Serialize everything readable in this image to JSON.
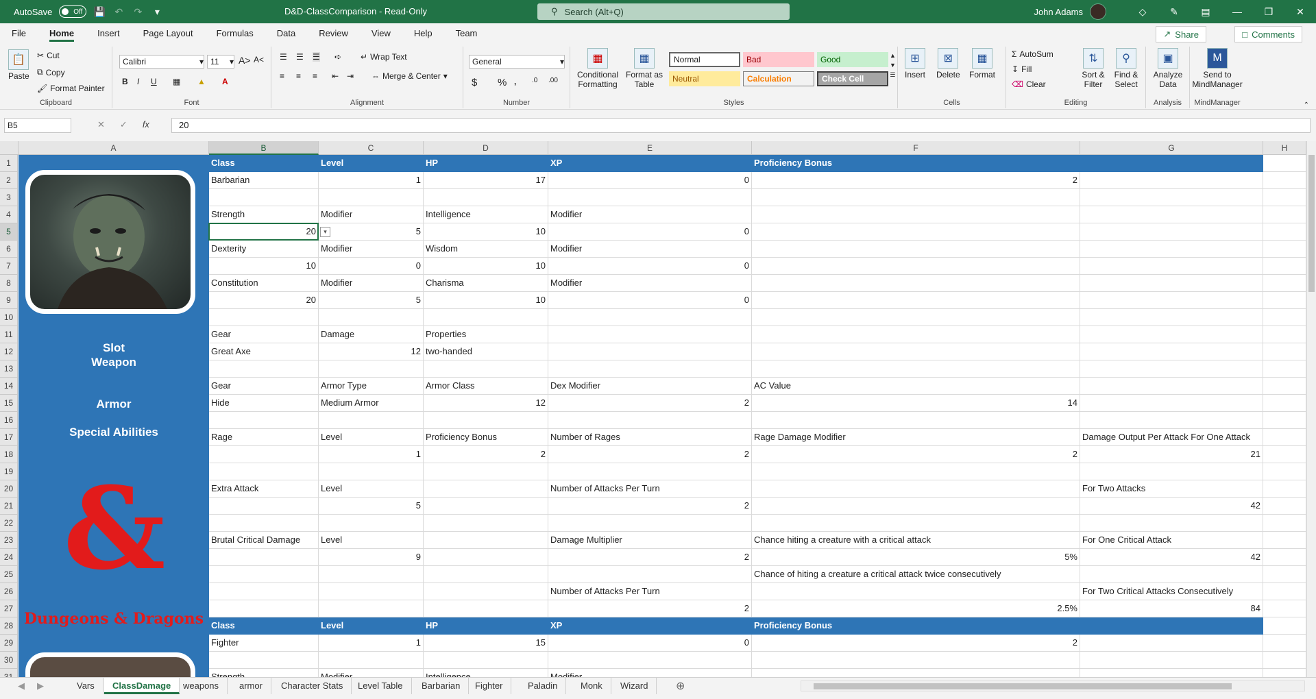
{
  "titlebar": {
    "autosave_label": "AutoSave",
    "autosave_state": "Off",
    "doc_title": "D&D-ClassComparison - Read-Only",
    "search_placeholder": "Search (Alt+Q)",
    "user_name": "John Adams"
  },
  "ribbon_tabs": [
    "File",
    "Home",
    "Insert",
    "Page Layout",
    "Formulas",
    "Data",
    "Review",
    "View",
    "Help",
    "Team"
  ],
  "share_label": "Share",
  "comments_label": "Comments",
  "ribbon": {
    "clipboard": {
      "label": "Clipboard",
      "paste": "Paste",
      "cut": "Cut",
      "copy": "Copy",
      "format_painter": "Format Painter"
    },
    "font": {
      "label": "Font",
      "family": "Calibri",
      "size": "11"
    },
    "alignment": {
      "label": "Alignment",
      "wrap_text": "Wrap Text",
      "merge_center": "Merge & Center"
    },
    "number": {
      "label": "Number",
      "format": "General"
    },
    "styles": {
      "label": "Styles",
      "conditional": "Conditional Formatting",
      "format_table": "Format as Table",
      "normal": "Normal",
      "bad": "Bad",
      "good": "Good",
      "neutral": "Neutral",
      "calculation": "Calculation",
      "check_cell": "Check Cell"
    },
    "cells": {
      "label": "Cells",
      "insert": "Insert",
      "delete": "Delete",
      "format": "Format"
    },
    "editing": {
      "label": "Editing",
      "autosum": "AutoSum",
      "fill": "Fill",
      "clear": "Clear",
      "sort_filter": "Sort & Filter",
      "find_select": "Find & Select"
    },
    "analysis": {
      "label": "Analysis",
      "analyze": "Analyze Data"
    },
    "mindmanager": {
      "label": "MindManager",
      "send": "Send to MindManager"
    }
  },
  "formula_bar": {
    "name_box": "B5",
    "formula": "20"
  },
  "columns": [
    "A",
    "B",
    "C",
    "D",
    "E",
    "F",
    "G",
    "H"
  ],
  "sidebar": {
    "slot": "Slot",
    "weapon": "Weapon",
    "armor": "Armor",
    "special": "Special Abilities",
    "logo_text": "Dungeons & Dragons"
  },
  "rows": [
    {
      "n": "1",
      "hdr": true,
      "B": "Class",
      "C": "Level",
      "D": "HP",
      "E": "XP",
      "F": "Proficiency Bonus",
      "G": ""
    },
    {
      "n": "2",
      "B": "Barbarian",
      "C": "1",
      "D": "17",
      "E": "0",
      "F": "2",
      "G": "",
      "num": [
        "C",
        "D",
        "E",
        "F"
      ]
    },
    {
      "n": "3"
    },
    {
      "n": "4",
      "B": "Strength",
      "C": "Modifier",
      "D": "Intelligence",
      "E": "Modifier"
    },
    {
      "n": "5",
      "B": "20",
      "C": "5",
      "D": "10",
      "E": "0",
      "num": [
        "B",
        "C",
        "D",
        "E"
      ]
    },
    {
      "n": "6",
      "B": "Dexterity",
      "C": "Modifier",
      "D": "Wisdom",
      "E": "Modifier"
    },
    {
      "n": "7",
      "B": "10",
      "C": "0",
      "D": "10",
      "E": "0",
      "num": [
        "B",
        "C",
        "D",
        "E"
      ]
    },
    {
      "n": "8",
      "B": "Constitution",
      "C": "Modifier",
      "D": "Charisma",
      "E": "Modifier"
    },
    {
      "n": "9",
      "B": "20",
      "C": "5",
      "D": "10",
      "E": "0",
      "num": [
        "B",
        "C",
        "D",
        "E"
      ]
    },
    {
      "n": "10"
    },
    {
      "n": "11",
      "B": "Gear",
      "C": "Damage",
      "D": "Properties"
    },
    {
      "n": "12",
      "B": "Great Axe",
      "C": "12",
      "D": "two-handed",
      "num": [
        "C"
      ]
    },
    {
      "n": "13"
    },
    {
      "n": "14",
      "B": "Gear",
      "C": "Armor Type",
      "D": "Armor Class",
      "E": "Dex Modifier",
      "F": "AC Value"
    },
    {
      "n": "15",
      "B": "Hide",
      "C": "Medium Armor",
      "D": "12",
      "E": "2",
      "F": "14",
      "num": [
        "D",
        "E",
        "F"
      ]
    },
    {
      "n": "16"
    },
    {
      "n": "17",
      "B": "Rage",
      "C": "Level",
      "D": "Proficiency Bonus",
      "E": "Number of Rages",
      "F": "Rage Damage Modifier",
      "G": "Damage Output Per Attack For One Attack"
    },
    {
      "n": "18",
      "C": "1",
      "D": "2",
      "E": "2",
      "F": "2",
      "G": "21",
      "num": [
        "C",
        "D",
        "E",
        "F",
        "G"
      ]
    },
    {
      "n": "19"
    },
    {
      "n": "20",
      "B": "Extra Attack",
      "C": "Level",
      "E": "Number of Attacks Per Turn",
      "G": "For Two Attacks"
    },
    {
      "n": "21",
      "C": "5",
      "E": "2",
      "G": "42",
      "num": [
        "C",
        "E",
        "G"
      ]
    },
    {
      "n": "22"
    },
    {
      "n": "23",
      "B": "Brutal Critical Damage",
      "C": "Level",
      "E": "Damage Multiplier",
      "F": "Chance hiting  a creature with a critical attack",
      "G": "For One Critical Attack"
    },
    {
      "n": "24",
      "C": "9",
      "E": "2",
      "F": "5%",
      "G": "42",
      "num": [
        "C",
        "E",
        "F",
        "G"
      ]
    },
    {
      "n": "25",
      "F": "Chance of hiting a creature a critical attack twice consecutively"
    },
    {
      "n": "26",
      "E": "Number of Attacks  Per Turn",
      "G": "For Two Critical Attacks Consecutively"
    },
    {
      "n": "27",
      "E": "2",
      "F": "2.5%",
      "G": "84",
      "num": [
        "E",
        "F",
        "G"
      ]
    },
    {
      "n": "28",
      "hdr": true,
      "B": "Class",
      "C": "Level",
      "D": "HP",
      "E": "XP",
      "F": "Proficiency Bonus",
      "G": ""
    },
    {
      "n": "29",
      "B": "Fighter",
      "C": "1",
      "D": "15",
      "E": "0",
      "F": "2",
      "num": [
        "C",
        "D",
        "E",
        "F"
      ]
    },
    {
      "n": "30"
    },
    {
      "n": "31",
      "B": "Strength",
      "C": "Modifier",
      "D": "Intelligence",
      "E": "Modifier"
    }
  ],
  "sheet_tabs": [
    "Vars",
    "ClassDamage",
    "weapons",
    "armor",
    "Character Stats",
    "Level Table",
    "Barbarian",
    "Fighter",
    "Paladin",
    "Monk",
    "Wizard"
  ],
  "active_sheet": "ClassDamage"
}
